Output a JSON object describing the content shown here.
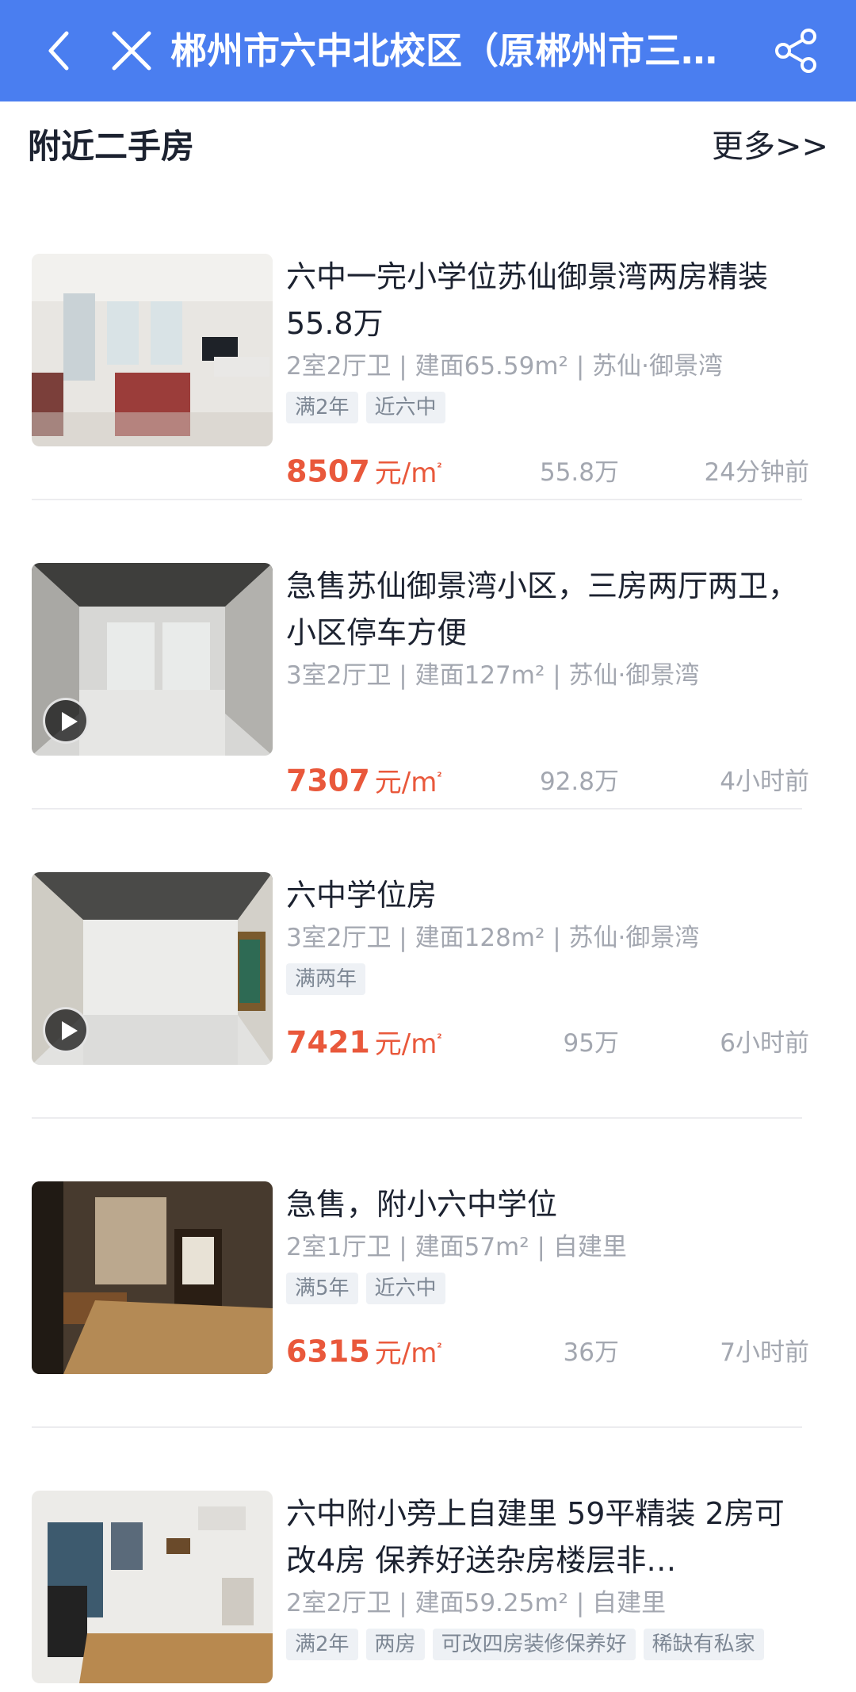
{
  "header": {
    "title": "郴州市六中北校区（原郴州市三中）",
    "back_icon": "chevron-left-icon",
    "close_icon": "close-icon",
    "share_icon": "share-icon",
    "bg_color": "#4a7ef0"
  },
  "section": {
    "title": "附近二手房",
    "more": "更多>>"
  },
  "price_color": "#e9583b",
  "listings": [
    {
      "title": "六中一完小学位苏仙御景湾两房精装55.8万",
      "meta": "2室2厅卫 | 建面65.59m² | 苏仙·御景湾",
      "tags": [
        "满2年",
        "近六中"
      ],
      "unit_price": "8507",
      "unit": "元/m",
      "unit_sup": "²",
      "total": "55.8万",
      "time": "24分钟前",
      "video": false
    },
    {
      "title": "急售苏仙御景湾小区，三房两厅两卫，小区停车方便",
      "meta": "3室2厅卫 | 建面127m² | 苏仙·御景湾",
      "tags": [],
      "unit_price": "7307",
      "unit": "元/m",
      "unit_sup": "²",
      "total": "92.8万",
      "time": "4小时前",
      "video": true
    },
    {
      "title": "六中学位房",
      "meta": "3室2厅卫 | 建面128m² | 苏仙·御景湾",
      "tags": [
        "满两年"
      ],
      "unit_price": "7421",
      "unit": "元/m",
      "unit_sup": "²",
      "total": "95万",
      "time": "6小时前",
      "video": true
    },
    {
      "title": "急售，附小六中学位",
      "meta": "2室1厅卫 | 建面57m² | 自建里",
      "tags": [
        "满5年",
        "近六中"
      ],
      "unit_price": "6315",
      "unit": "元/m",
      "unit_sup": "²",
      "total": "36万",
      "time": "7小时前",
      "video": false
    },
    {
      "title": "六中附小旁上自建里 59平精装 2房可改4房 保养好送杂房楼层非…",
      "meta": "2室2厅卫 | 建面59.25m² | 自建里",
      "tags": [
        "满2年",
        "两房",
        "可改四房装修保养好",
        "稀缺有私家"
      ],
      "video": false
    }
  ]
}
